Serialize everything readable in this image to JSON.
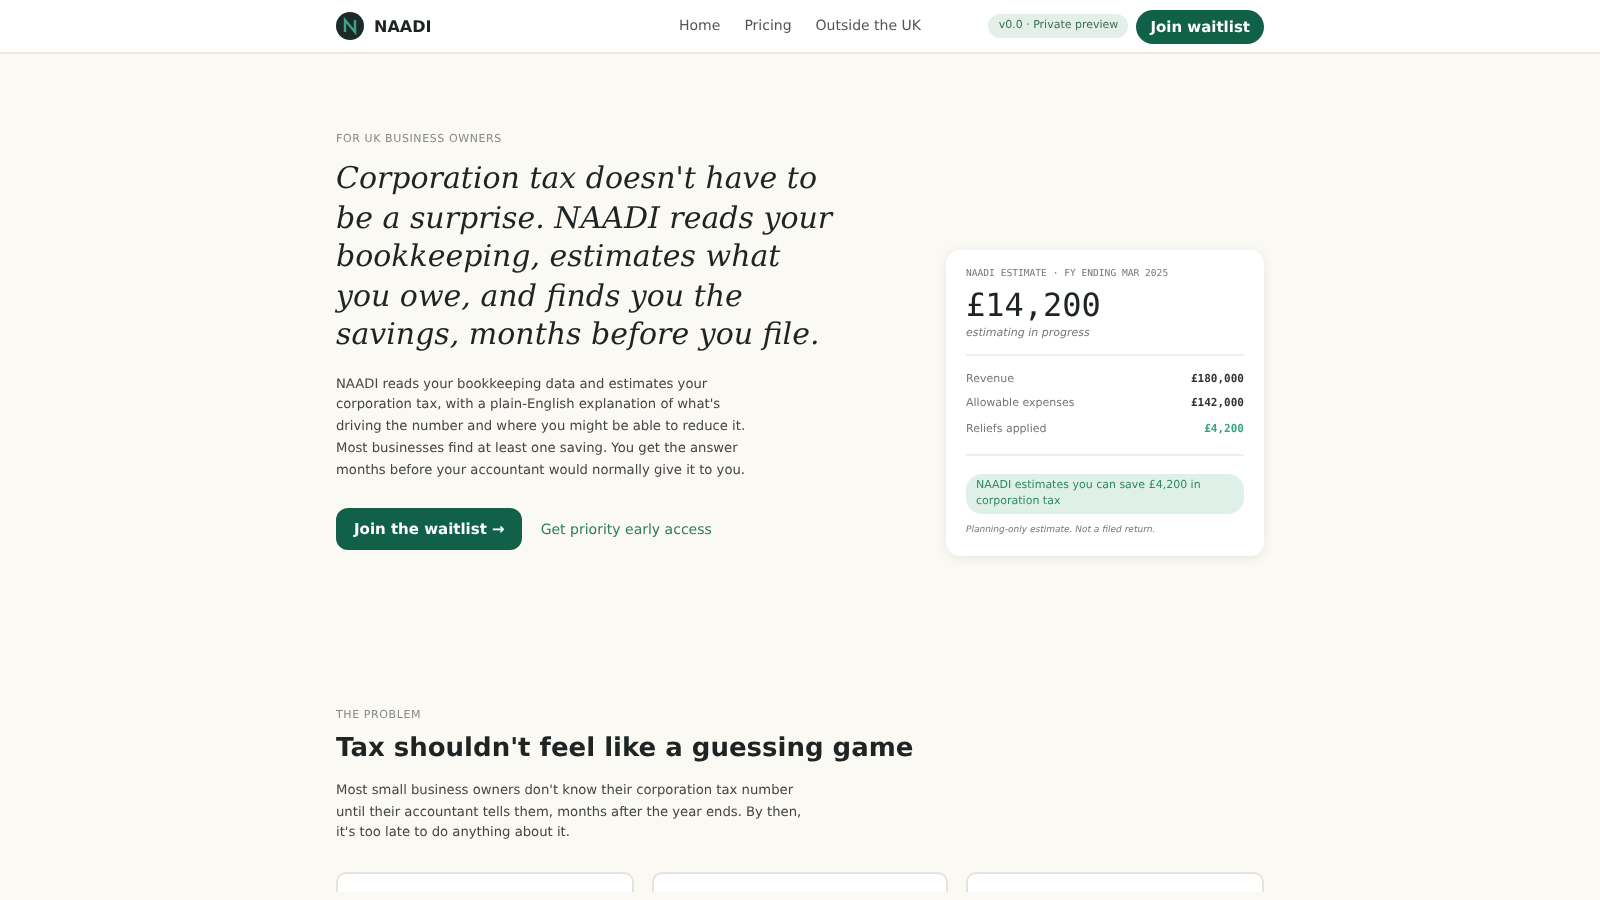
{
  "header": {
    "logo_text": "NAADI",
    "nav": [
      {
        "label": "Home"
      },
      {
        "label": "Pricing"
      },
      {
        "label": "Outside the UK"
      }
    ],
    "badge": "v0.0 · Private preview",
    "cta": "Join waitlist"
  },
  "hero": {
    "eyebrow": "FOR UK BUSINESS OWNERS",
    "title": "Corporation tax doesn't have to be a surprise. NAADI reads your bookkeeping, estimates what you owe, and finds you the savings, months before you file.",
    "body": "NAADI reads your bookkeeping data and estimates your corporation tax, with a plain-English explanation of what's driving the number and where you might be able to reduce it. Most businesses find at least one saving. You get the answer months before your accountant would normally give it to you.",
    "primary_button": "Join the waitlist →",
    "secondary_link": "Get priority early access"
  },
  "estimate_card": {
    "label": "NAADI ESTIMATE · FY ENDING MAR 2025",
    "amount": "£14,200",
    "status": "estimating in progress",
    "rows": [
      {
        "label": "Revenue",
        "value": "£180,000",
        "highlight": false
      },
      {
        "label": "Allowable expenses",
        "value": "£142,000",
        "highlight": false
      },
      {
        "label": "Reliefs applied",
        "value": "£4,200",
        "highlight": true
      }
    ],
    "savings_note": "NAADI estimates you can save £4,200 in corporation tax",
    "disclaimer": "Planning-only estimate. Not a filed return."
  },
  "problem": {
    "eyebrow": "THE PROBLEM",
    "title": "Tax shouldn't feel like a guessing game",
    "body": "Most small business owners don't know their corporation tax number until their accountant tells them, months after the year ends. By then, it's too late to do anything about it.",
    "cards": [
      {
        "kind": "empty"
      },
      {
        "kind": "empty"
      },
      {
        "kind": "empty"
      }
    ]
  }
}
